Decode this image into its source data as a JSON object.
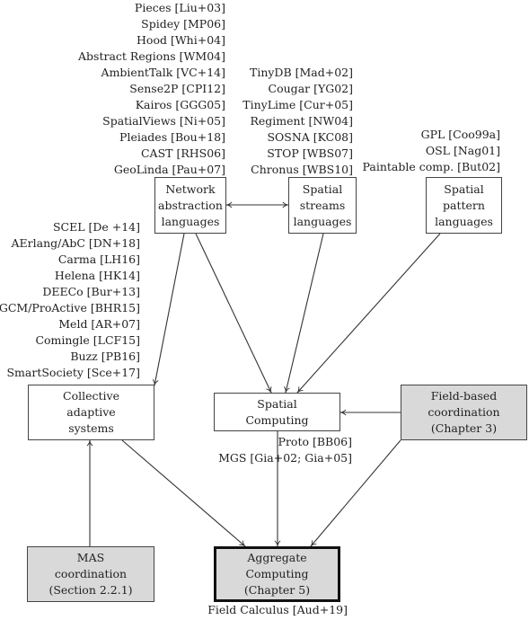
{
  "nodes": {
    "network": {
      "lines": [
        "Network",
        "abstraction",
        "languages"
      ]
    },
    "streams": {
      "lines": [
        "Spatial",
        "streams",
        "languages"
      ]
    },
    "pattern": {
      "lines": [
        "Spatial",
        "pattern",
        "languages"
      ]
    },
    "collective": {
      "lines": [
        "Collective",
        "adaptive",
        "systems"
      ]
    },
    "spatial_computing": {
      "lines": [
        "Spatial",
        "Computing"
      ]
    },
    "field_based": {
      "lines": [
        "Field-based",
        "coordination",
        "(Chapter 3)"
      ]
    },
    "mas": {
      "lines": [
        "MAS",
        "coordination",
        "(Section 2.2.1)"
      ]
    },
    "aggregate": {
      "lines": [
        "Aggregate",
        "Computing",
        "(Chapter 5)"
      ]
    }
  },
  "lists": {
    "network": [
      "Pieces [Liu+03]",
      "Spidey [MP06]",
      "Hood [Whi+04]",
      "Abstract Regions [WM04]",
      "AmbientTalk [VC+14]",
      "Sense2P [CPI12]",
      "Kairos [GGG05]",
      "SpatialViews [Ni+05]",
      "Pleiades [Bou+18]",
      "CAST [RHS06]",
      "GeoLinda [Pau+07]"
    ],
    "streams": [
      "TinyDB [Mad+02]",
      "Cougar [YG02]",
      "TinyLime [Cur+05]",
      "Regiment [NW04]",
      "SOSNA [KC08]",
      "STOP [WBS07]",
      "Chronus [WBS10]"
    ],
    "pattern": [
      "GPL [Coo99a]",
      "OSL [Nag01]",
      "Paintable comp. [But02]"
    ],
    "collective": [
      "SCEL [De +14]",
      "AErlang/AbC [DN+18]",
      "Carma [LH16]",
      "Helena [HK14]",
      "DEECo [Bur+13]",
      "GCM/ProActive [BHR15]",
      "Meld [AR+07]",
      "Comingle [LCF15]",
      "Buzz [PB16]",
      "SmartSociety [Sce+17]"
    ],
    "spatial_computing": [
      "Proto [BB06]",
      "MGS [Gia+02; Gia+05]"
    ],
    "aggregate": [
      "Field Calculus [Aud+19]"
    ]
  },
  "edges": [
    {
      "from": "network",
      "to": "streams",
      "direction": "both"
    },
    {
      "from": "network",
      "to": "collective",
      "direction": "forward"
    },
    {
      "from": "network",
      "to": "spatial_computing",
      "direction": "forward"
    },
    {
      "from": "streams",
      "to": "spatial_computing",
      "direction": "forward"
    },
    {
      "from": "pattern",
      "to": "spatial_computing",
      "direction": "forward"
    },
    {
      "from": "field_based",
      "to": "spatial_computing",
      "direction": "forward"
    },
    {
      "from": "mas",
      "to": "collective",
      "direction": "forward"
    },
    {
      "from": "collective",
      "to": "aggregate",
      "direction": "forward"
    },
    {
      "from": "spatial_computing",
      "to": "aggregate",
      "direction": "forward"
    },
    {
      "from": "field_based",
      "to": "aggregate",
      "direction": "forward"
    }
  ]
}
